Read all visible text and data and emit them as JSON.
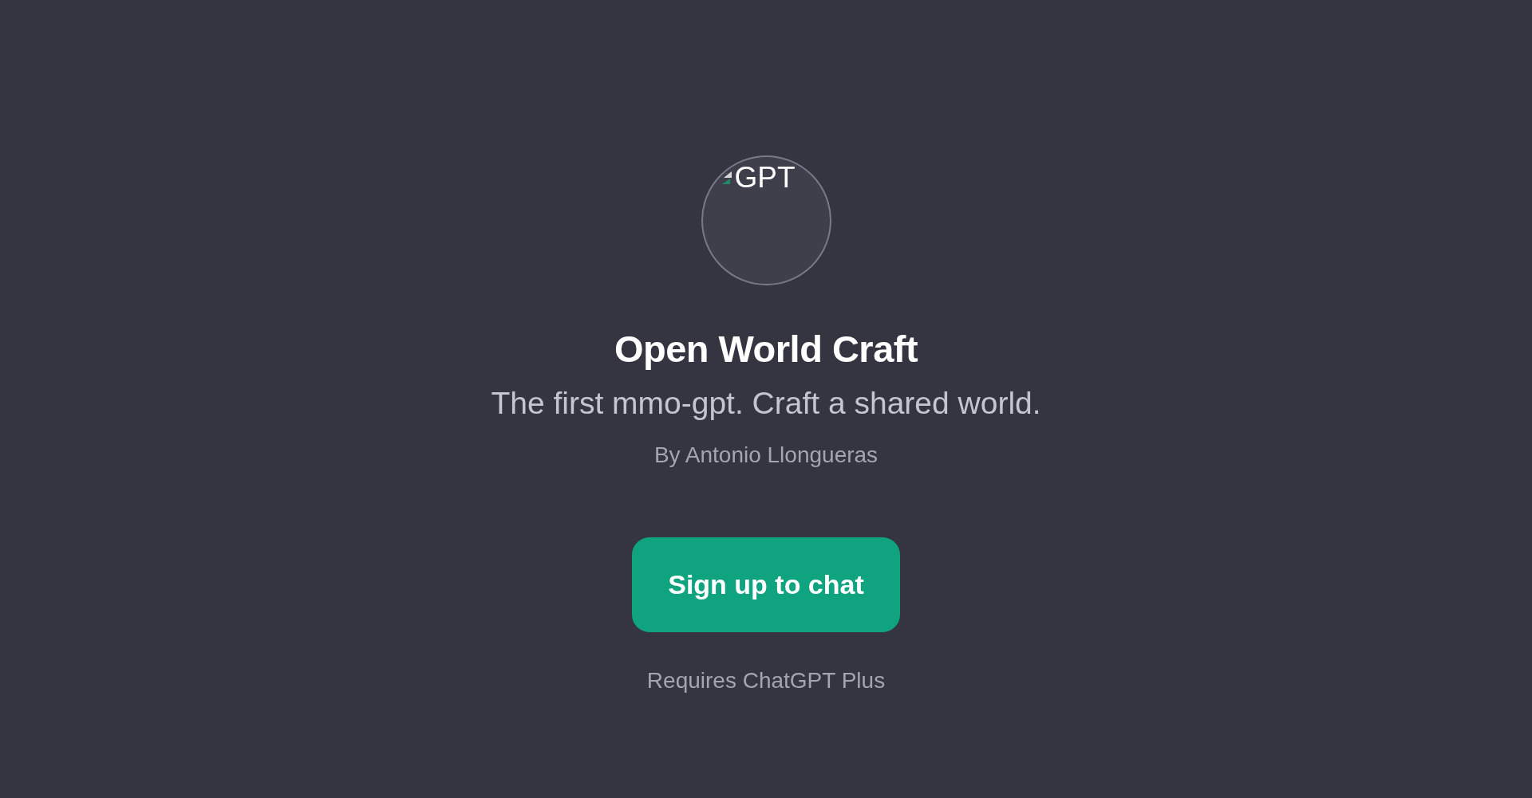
{
  "avatar": {
    "alt_text": "GPT"
  },
  "title": "Open World Craft",
  "description": "The first mmo-gpt. Craft a shared world.",
  "author": "By Antonio Llongueras",
  "button": {
    "label": "Sign up to chat"
  },
  "note": "Requires ChatGPT Plus"
}
